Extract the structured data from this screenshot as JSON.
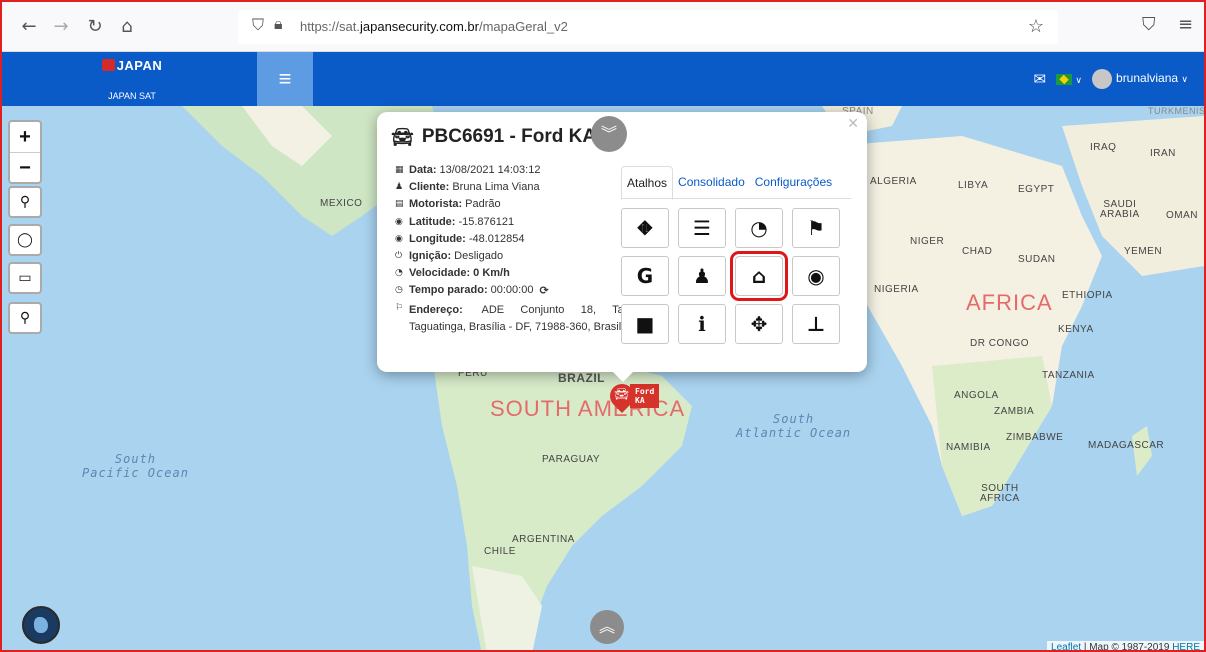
{
  "browser": {
    "url_prefix": "https://sat.",
    "url_domain": "japansecurity.com.br",
    "url_path": "/mapaGeral_v2"
  },
  "header": {
    "brand": "JAPAN",
    "brand_sub": "JAPAN SAT",
    "username": "brunalviana",
    "colors": {
      "header": "#0a5ac8",
      "toggle": "#5d9be2"
    }
  },
  "map": {
    "labels": {
      "mexico": "MEXICO",
      "peru": "PERU",
      "brazil": "BRAZIL",
      "paraguay": "PARAGUAY",
      "chile": "CHILE",
      "argentina": "ARGENTINA",
      "algeria": "ALGERIA",
      "libya": "LIBYA",
      "egypt": "EGYPT",
      "iraq": "IRAQ",
      "iran": "IRAN",
      "saudi": "SAUDI\nARABIA",
      "oman": "OMAN",
      "yemen": "YEMEN",
      "niger": "NIGER",
      "chad": "CHAD",
      "sudan": "SUDAN",
      "nigeria": "NIGERIA",
      "ethiopia": "ETHIOPIA",
      "kenya": "KENYA",
      "drcongo": "DR CONGO",
      "tanzania": "TANZANIA",
      "angola": "ANGOLA",
      "zambia": "ZAMBIA",
      "zimbabwe": "ZIMBABWE",
      "namibia": "NAMIBIA",
      "madagascar": "MADAGASCAR",
      "southafrica": "SOUTH\nAFRICA",
      "spain": "SPAIN",
      "turkmenistan": "TURKMENIST"
    },
    "continents": {
      "africa": "AFRICA",
      "south_america": "SOUTH AMERICA"
    },
    "oceans": {
      "south_atlantic": "South\nAtlantic Ocean",
      "south_pacific": "South\nPacific Ocean"
    },
    "marker_label": "Ford KA",
    "attribution_link": "Leaflet",
    "attribution_text": " | Map © 1987-2019 ",
    "attribution_here": "HERE"
  },
  "popup": {
    "title": "PBC6691 - Ford KA",
    "rows": [
      {
        "icon": "calendar-icon",
        "key": "Data:",
        "value": "13/08/2021 14:03:12",
        "bold": false
      },
      {
        "icon": "user-icon",
        "key": "Cliente:",
        "value": "Bruna Lima Viana",
        "bold": false
      },
      {
        "icon": "id-card-icon",
        "key": "Motorista:",
        "value": "Padrão",
        "bold": false
      },
      {
        "icon": "location-icon",
        "key": "Latitude:",
        "value": "-15.876121",
        "bold": false
      },
      {
        "icon": "location-icon",
        "key": "Longitude:",
        "value": "-48.012854",
        "bold": false
      },
      {
        "icon": "power-icon",
        "key": "Ignição:",
        "value": "Desligado",
        "bold": false
      },
      {
        "icon": "speedometer-icon",
        "key": "Velocidade:",
        "value": "0 Km/h",
        "bold": true
      },
      {
        "icon": "clock-icon",
        "key": "Tempo parado:",
        "value": "00:00:00",
        "bold": false
      }
    ],
    "address_key": "Endereço:",
    "address_value": "ADE Conjunto 18, Taguatinga, Taguatinga, Brasília - DF, 71988-360, Brasil",
    "tabs": [
      "Atalhos",
      "Consolidado",
      "Configurações"
    ],
    "shortcuts": [
      {
        "name": "road-icon",
        "glyph": "⛖"
      },
      {
        "name": "ordered-list-icon",
        "glyph": "☰"
      },
      {
        "name": "speedometer-icon",
        "glyph": "◔"
      },
      {
        "name": "checkered-flag-icon",
        "glyph": "⚑"
      },
      {
        "name": "google-icon",
        "glyph": "G"
      },
      {
        "name": "street-view-icon",
        "glyph": "♟"
      },
      {
        "name": "home-icon",
        "glyph": "⌂",
        "highlight": true
      },
      {
        "name": "target-icon",
        "glyph": "◉"
      },
      {
        "name": "video-camera-icon",
        "glyph": "■"
      },
      {
        "name": "info-icon",
        "glyph": "ℹ"
      },
      {
        "name": "move-icon",
        "glyph": "✥"
      },
      {
        "name": "pushpin-icon",
        "glyph": "⊥"
      }
    ]
  }
}
